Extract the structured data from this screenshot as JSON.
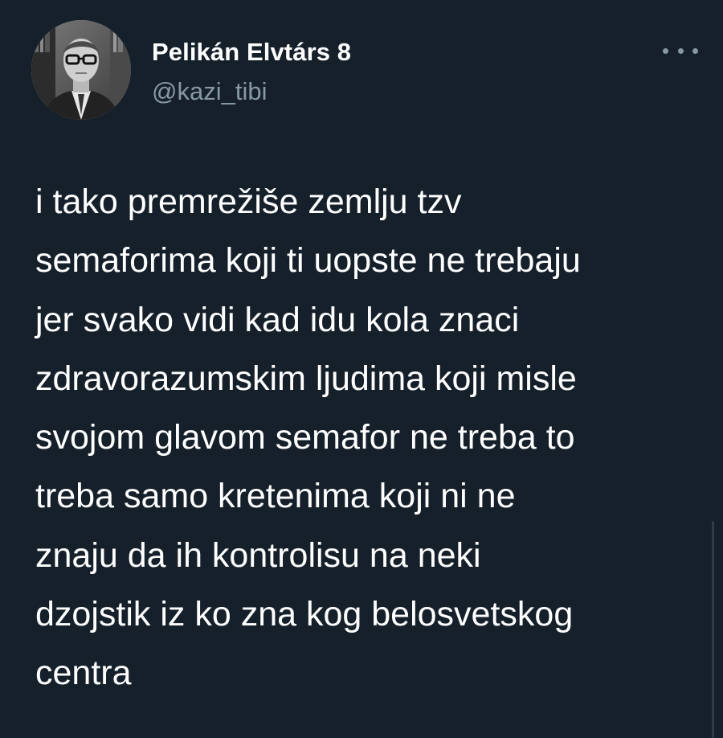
{
  "tweet": {
    "author": {
      "display_name": "Pelikán Elvtárs 8",
      "handle": "@kazi_tibi",
      "avatar_icon": "profile-photo-avatar-icon"
    },
    "more_icon": "more-options-ellipsis-icon",
    "text_lines": [
      "i tako premrežiše zemlju tzv",
      "semaforima koji ti uopste ne trebaju",
      "jer svako vidi kad idu kola znaci",
      "zdravorazumskim ljudima koji misle",
      "svojom glavom semafor ne treba to",
      "treba samo kretenima koji ni ne",
      "znaju da ih kontrolisu na neki",
      "dzojstik iz ko zna kog belosvetskog",
      "centra"
    ]
  },
  "colors": {
    "background": "#15202b",
    "text_primary": "#ffffff",
    "text_secondary": "#8899a6"
  }
}
